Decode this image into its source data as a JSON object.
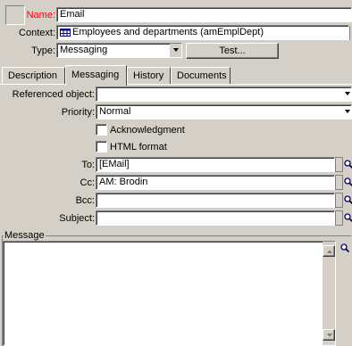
{
  "header": {
    "name_label": "Name:",
    "name_value": "Email",
    "context_label": "Context:",
    "context_value": "Employees and departments (amEmplDept)",
    "type_label": "Type:",
    "type_value": "Messaging",
    "test_button": "Test..."
  },
  "tabs": [
    {
      "label": "Description",
      "active": false
    },
    {
      "label": "Messaging",
      "active": true
    },
    {
      "label": "History",
      "active": false
    },
    {
      "label": "Documents",
      "active": false
    }
  ],
  "messaging": {
    "referenced_object_label": "Referenced object:",
    "referenced_object_value": "",
    "priority_label": "Priority:",
    "priority_value": "Normal",
    "acknowledgment_label": "Acknowledgment",
    "acknowledgment_checked": false,
    "html_format_label": "HTML format",
    "html_format_checked": false,
    "to_label": "To:",
    "to_value": "[EMail]",
    "cc_label": "Cc:",
    "cc_value": "AM: Brodin",
    "bcc_label": "Bcc:",
    "bcc_value": "",
    "subject_label": "Subject:",
    "subject_value": "",
    "message_group_label": "Message",
    "message_value": ""
  },
  "colors": {
    "name_label": "#ff0000",
    "window_bg": "#d4d0c8",
    "field_bg": "#ffffff"
  }
}
